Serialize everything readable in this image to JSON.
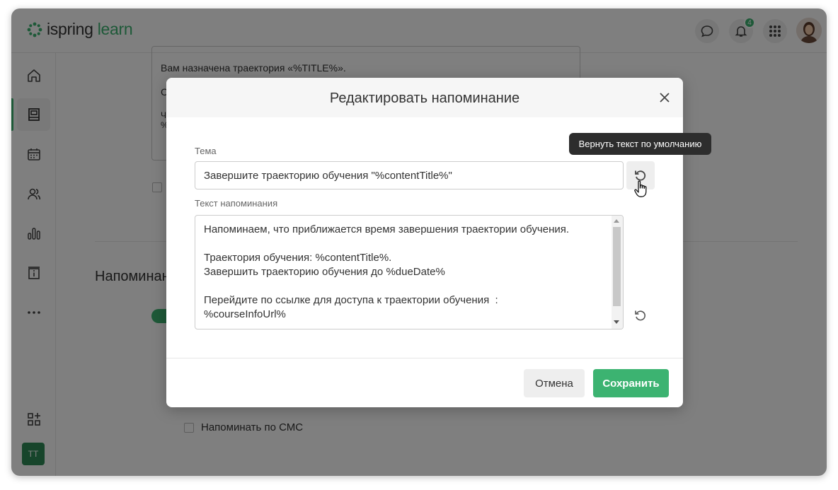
{
  "header": {
    "logo_text_main": "ispring",
    "logo_text_accent": "learn",
    "notifications_count": "4"
  },
  "sidebar": {
    "items": [
      {
        "icon": "home-icon"
      },
      {
        "icon": "book-icon",
        "active": true
      },
      {
        "icon": "calendar-icon"
      },
      {
        "icon": "users-icon"
      },
      {
        "icon": "bar-chart-icon"
      },
      {
        "icon": "info-card-icon"
      },
      {
        "icon": "more-icon"
      }
    ],
    "user_initials": "TT"
  },
  "background": {
    "template_line1": "Вам назначена траектория «%TITLE%».",
    "template_line2": "С",
    "template_line3": "Ч",
    "template_line4": "%",
    "section_title": "Напоминан",
    "sms_label": "Напоминать по СМС"
  },
  "modal": {
    "title": "Редактировать напоминание",
    "subject_label": "Тема",
    "subject_value": "Завершите траекторию обучения \"%contentTitle%\"",
    "body_label": "Текст напоминания",
    "body_value": "Напоминаем, что приближается время завершения траектории обучения.\n\nТраектория обучения: %contentTitle%.\nЗавершить траекторию обучения до %dueDate%\n\nПерейдите по ссылке для доступа к траектории обучения  :\n%courseInfoUrl%",
    "cancel_label": "Отмена",
    "save_label": "Сохранить"
  },
  "tooltip": {
    "text": "Вернуть текст по умолчанию"
  },
  "colors": {
    "accent": "#3cb371",
    "overlay": "rgba(0,0,0,0.5)"
  }
}
